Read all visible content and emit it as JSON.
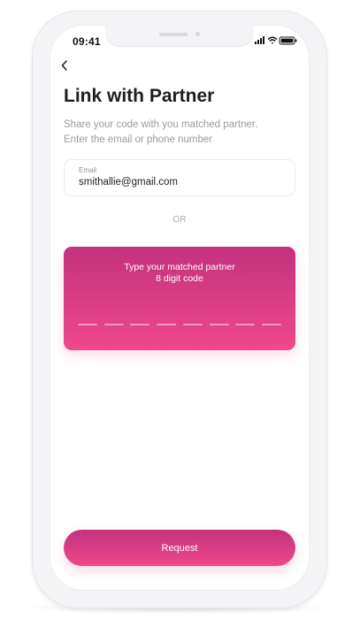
{
  "status_bar": {
    "time": "09:41",
    "icons": [
      "cellular-signal-icon",
      "wifi-icon",
      "battery-icon"
    ]
  },
  "header": {
    "back_icon": "chevron-left-icon",
    "title": "Link with Partner",
    "subtitle_line1": "Share your code with you matched partner.",
    "subtitle_line2": "Enter the email or phone number"
  },
  "email": {
    "label": "Email",
    "value": "smithallie@gmail.com"
  },
  "divider": {
    "text": "OR"
  },
  "code_card": {
    "prompt_line1": "Type your matched partner",
    "prompt_line2": "8 digit code",
    "digits": 8
  },
  "actions": {
    "request_label": "Request"
  },
  "colors": {
    "accent_top": "#c2327e",
    "accent_bottom": "#f0488a",
    "title": "#1d1d22",
    "muted": "#9a9aa2"
  }
}
